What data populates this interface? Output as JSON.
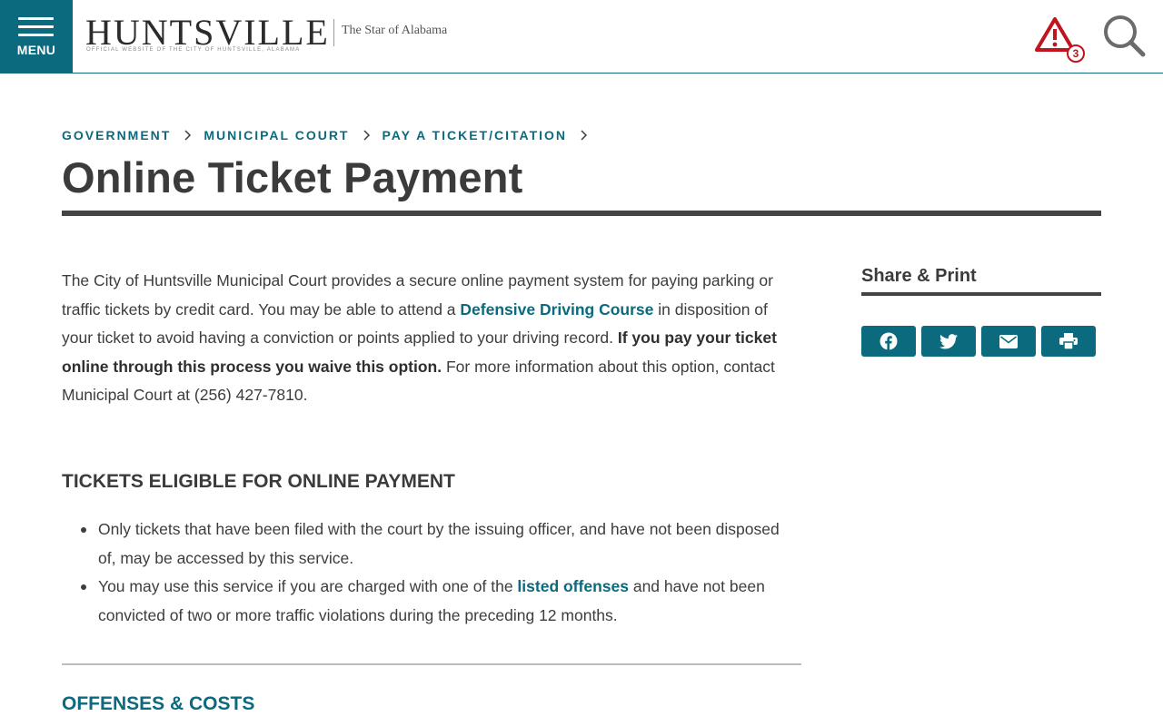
{
  "header": {
    "menu_label": "MENU",
    "logo_title": "HUNTSVILLE",
    "logo_subtitle": "OFFICIAL WEBSITE OF THE CITY OF HUNTSVILLE, ALABAMA",
    "logo_tagline": "The Star of Alabama",
    "alert_count": "3",
    "icons": [
      "menu-icon",
      "alert-icon",
      "search-icon"
    ],
    "alert_color": "#c0151f",
    "brand_color": "#0b6a7d"
  },
  "breadcrumb": [
    {
      "label": "GOVERNMENT"
    },
    {
      "label": "MUNICIPAL COURT"
    },
    {
      "label": "PAY A TICKET/CITATION"
    }
  ],
  "page": {
    "title": "Online Ticket Payment"
  },
  "intro": {
    "part1": "The City of Huntsville Municipal Court provides a secure online payment system for paying parking or traffic tickets by credit card. You may be able to attend a ",
    "link_defensive": "Defensive Driving Course",
    "part2": " in disposition of your ticket to avoid having a conviction or points applied to your driving record.  ",
    "bold": "If you pay your ticket online through this process you waive this option.",
    "part3": "  For more information about this option, contact Municipal Court at (256) 427-7810."
  },
  "eligible": {
    "heading": "TICKETS ELIGIBLE FOR ONLINE PAYMENT",
    "bullet1": "Only tickets that have been filed with the court by the issuing officer, and have not been disposed of, may be accessed by this service.",
    "bullet2_pre": "You may use this service if you are charged with one of the ",
    "bullet2_link": "listed offenses",
    "bullet2_post": " and have not been convicted of two or more traffic violations during the preceding 12 months."
  },
  "offenses": {
    "heading": "OFFENSES & COSTS"
  },
  "sidebar": {
    "share_title": "Share & Print",
    "buttons": [
      "facebook-icon",
      "twitter-icon",
      "email-icon",
      "print-icon"
    ]
  }
}
